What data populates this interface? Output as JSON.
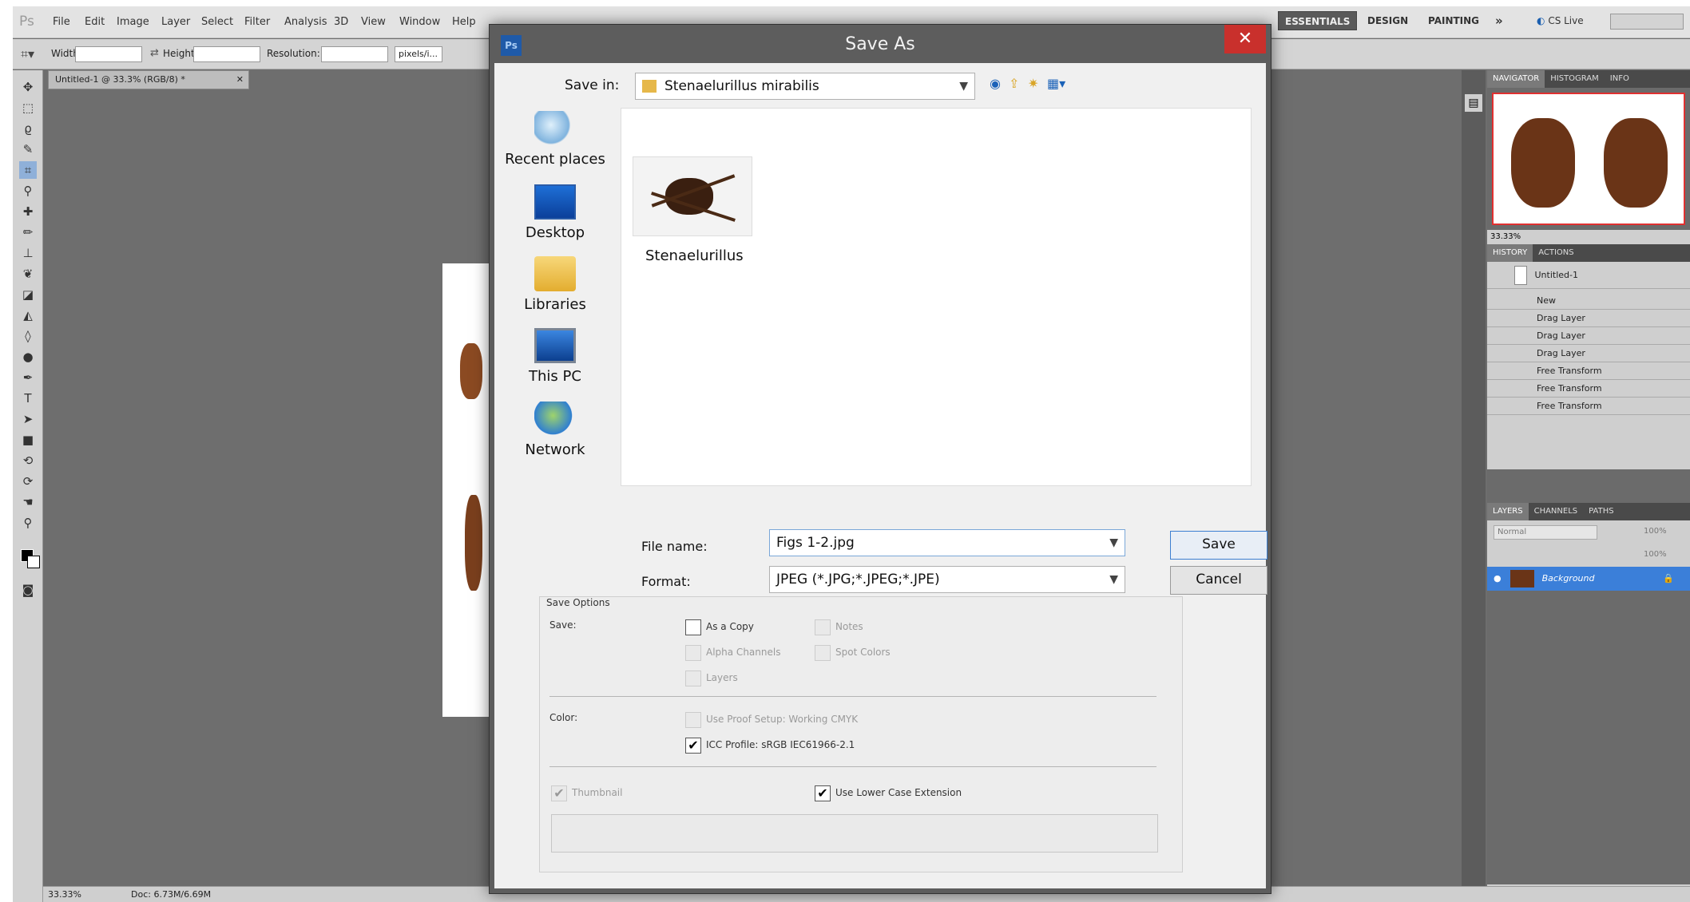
{
  "app": {
    "logo": "Ps",
    "menu": [
      "File",
      "Edit",
      "Image",
      "Layer",
      "Select",
      "Filter",
      "Analysis",
      "3D",
      "View",
      "Window",
      "Help"
    ],
    "workspaces": [
      "ESSENTIALS",
      "DESIGN",
      "PAINTING"
    ],
    "more_glyph": "»",
    "cslive": "CS Live"
  },
  "options_bar": {
    "width_label": "Width:",
    "height_label": "Height:",
    "resolution_label": "Resolution:",
    "units": "pixels/i..."
  },
  "document": {
    "tab_title": "Untitled-1 @ 33.3% (RGB/8) *"
  },
  "status_bar": {
    "zoom": "33.33%",
    "doc": "Doc: 6.73M/6.69M"
  },
  "panels": {
    "navigator_tabs": [
      "NAVIGATOR",
      "HISTOGRAM",
      "INFO"
    ],
    "navigator_zoom": "33.33%",
    "history_tabs": [
      "HISTORY",
      "ACTIONS"
    ],
    "history_snapshot": "Untitled-1",
    "history_items": [
      "New",
      "Drag Layer",
      "Drag Layer",
      "Drag Layer",
      "Free Transform",
      "Free Transform",
      "Free Transform"
    ],
    "layers_tabs": [
      "LAYERS",
      "CHANNELS",
      "PATHS"
    ],
    "blend_mode": "Normal",
    "opacity": "100%",
    "fill": "100%",
    "layer_name": "Background"
  },
  "dialog": {
    "title": "Save As",
    "close_glyph": "✕",
    "save_in_label": "Save in:",
    "save_in_value": "Stenaelurillus mirabilis",
    "places": [
      "Recent places",
      "Desktop",
      "Libraries",
      "This PC",
      "Network"
    ],
    "file_item": "Stenaelurillus",
    "file_name_label": "File name:",
    "file_name_value": "Figs 1-2.jpg",
    "format_label": "Format:",
    "format_value": "JPEG (*.JPG;*.JPEG;*.JPE)",
    "save_button": "Save",
    "cancel_button": "Cancel",
    "save_options": {
      "title": "Save Options",
      "save_label": "Save:",
      "as_a_copy": "As a Copy",
      "notes": "Notes",
      "alpha_channels": "Alpha Channels",
      "spot_colors": "Spot Colors",
      "layers": "Layers",
      "color_label": "Color:",
      "use_proof_setup": "Use Proof Setup:  Working CMYK",
      "icc_profile": "ICC Profile:  sRGB IEC61966-2.1",
      "thumbnail": "Thumbnail",
      "lower_case": "Use Lower Case Extension"
    }
  }
}
